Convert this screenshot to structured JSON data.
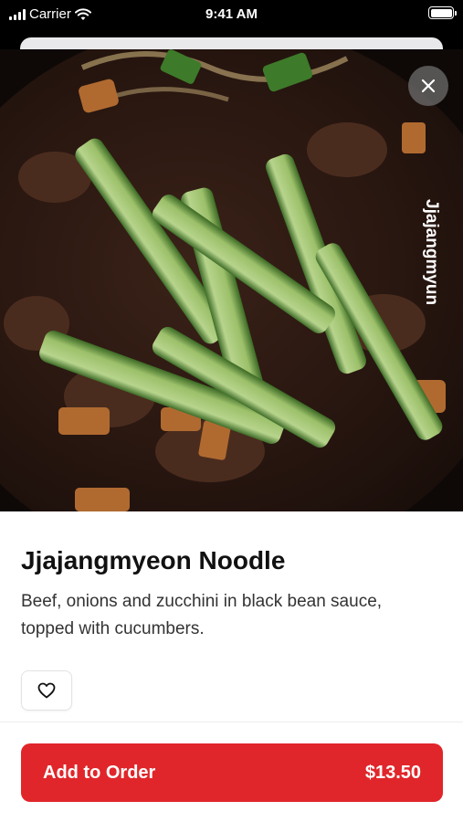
{
  "status_bar": {
    "carrier": "Carrier",
    "time": "9:41 AM",
    "battery_level": 1.0
  },
  "image": {
    "watermark_text": "Jjajangmyun"
  },
  "item": {
    "title": "Jjajangmyeon Noodle",
    "description": "Beef, onions and zucchini in black bean sauce, topped with cucumbers."
  },
  "actions": {
    "close_icon": "close-icon",
    "favorite_icon": "heart-icon",
    "add_to_order_label": "Add to Order",
    "price": "$13.50"
  },
  "colors": {
    "accent": "#e0262a",
    "close_button_bg": "#6e6e6e",
    "sauce": "#2a1812",
    "cucumber": "#a8c97a"
  }
}
